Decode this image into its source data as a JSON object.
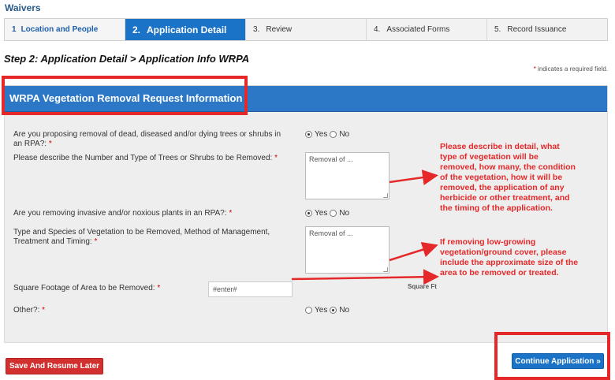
{
  "header": {
    "title": "Waivers"
  },
  "steps": [
    {
      "num": "1",
      "label": "Location and People",
      "state": "done"
    },
    {
      "num": "2.",
      "label": "Application Detail",
      "state": "active"
    },
    {
      "num": "3.",
      "label": "Review",
      "state": "todo"
    },
    {
      "num": "4.",
      "label": "Associated Forms",
      "state": "todo"
    },
    {
      "num": "5.",
      "label": "Record Issuance",
      "state": "todo"
    }
  ],
  "page": {
    "heading": "Step 2: Application Detail > Application Info WRPA",
    "required_note_asterisk": "*",
    "required_note": " indicates a required field."
  },
  "panel": {
    "title": "WRPA Vegetation Removal Request Information",
    "questions": {
      "q1": {
        "line1": "Are you proposing removal of dead, diseased and/or dying trees or shrubs in",
        "line2": "an RPA?:",
        "asterisk": "*",
        "yes": "Yes",
        "no": "No",
        "selected": "Yes"
      },
      "q2": {
        "label": "Please describe the Number and Type of Trees or Shrubs to be Removed:",
        "asterisk": "*",
        "value": "Removal of ..."
      },
      "q3": {
        "label": "Are you removing invasive and/or noxious plants in an RPA?:",
        "asterisk": "*",
        "yes": "Yes",
        "no": "No",
        "selected": "Yes"
      },
      "q4": {
        "line1": "Type and Species of Vegetation to be Removed, Method of Management,",
        "line2": "Treatment and Timing:",
        "asterisk": "*",
        "value": "Removal of ..."
      },
      "q5": {
        "label": "Square Footage of Area to be Removed:",
        "asterisk": "*",
        "value": "#enter#",
        "unit": "Square Ft"
      },
      "q6": {
        "label": "Other?:",
        "asterisk": "*",
        "yes": "Yes",
        "no": "No",
        "selected": "No"
      }
    }
  },
  "annotations": {
    "note1": [
      "Please describe in detail, what",
      "type of vegetation will be",
      "removed, how many, the condition",
      "of the vegetation, how it will be",
      "removed, the application of any",
      "herbicide or other treatment, and",
      "the timing of the application."
    ],
    "note2": [
      "If removing low-growing",
      "vegetation/ground cover, please",
      "include the approximate size of the",
      "area to be removed or treated."
    ]
  },
  "buttons": {
    "save": "Save And Resume Later",
    "continue": "Continue Application »"
  },
  "colors": {
    "accent_blue": "#1a73c7",
    "annotation_red": "#e5282a",
    "save_red": "#d22f2f"
  }
}
